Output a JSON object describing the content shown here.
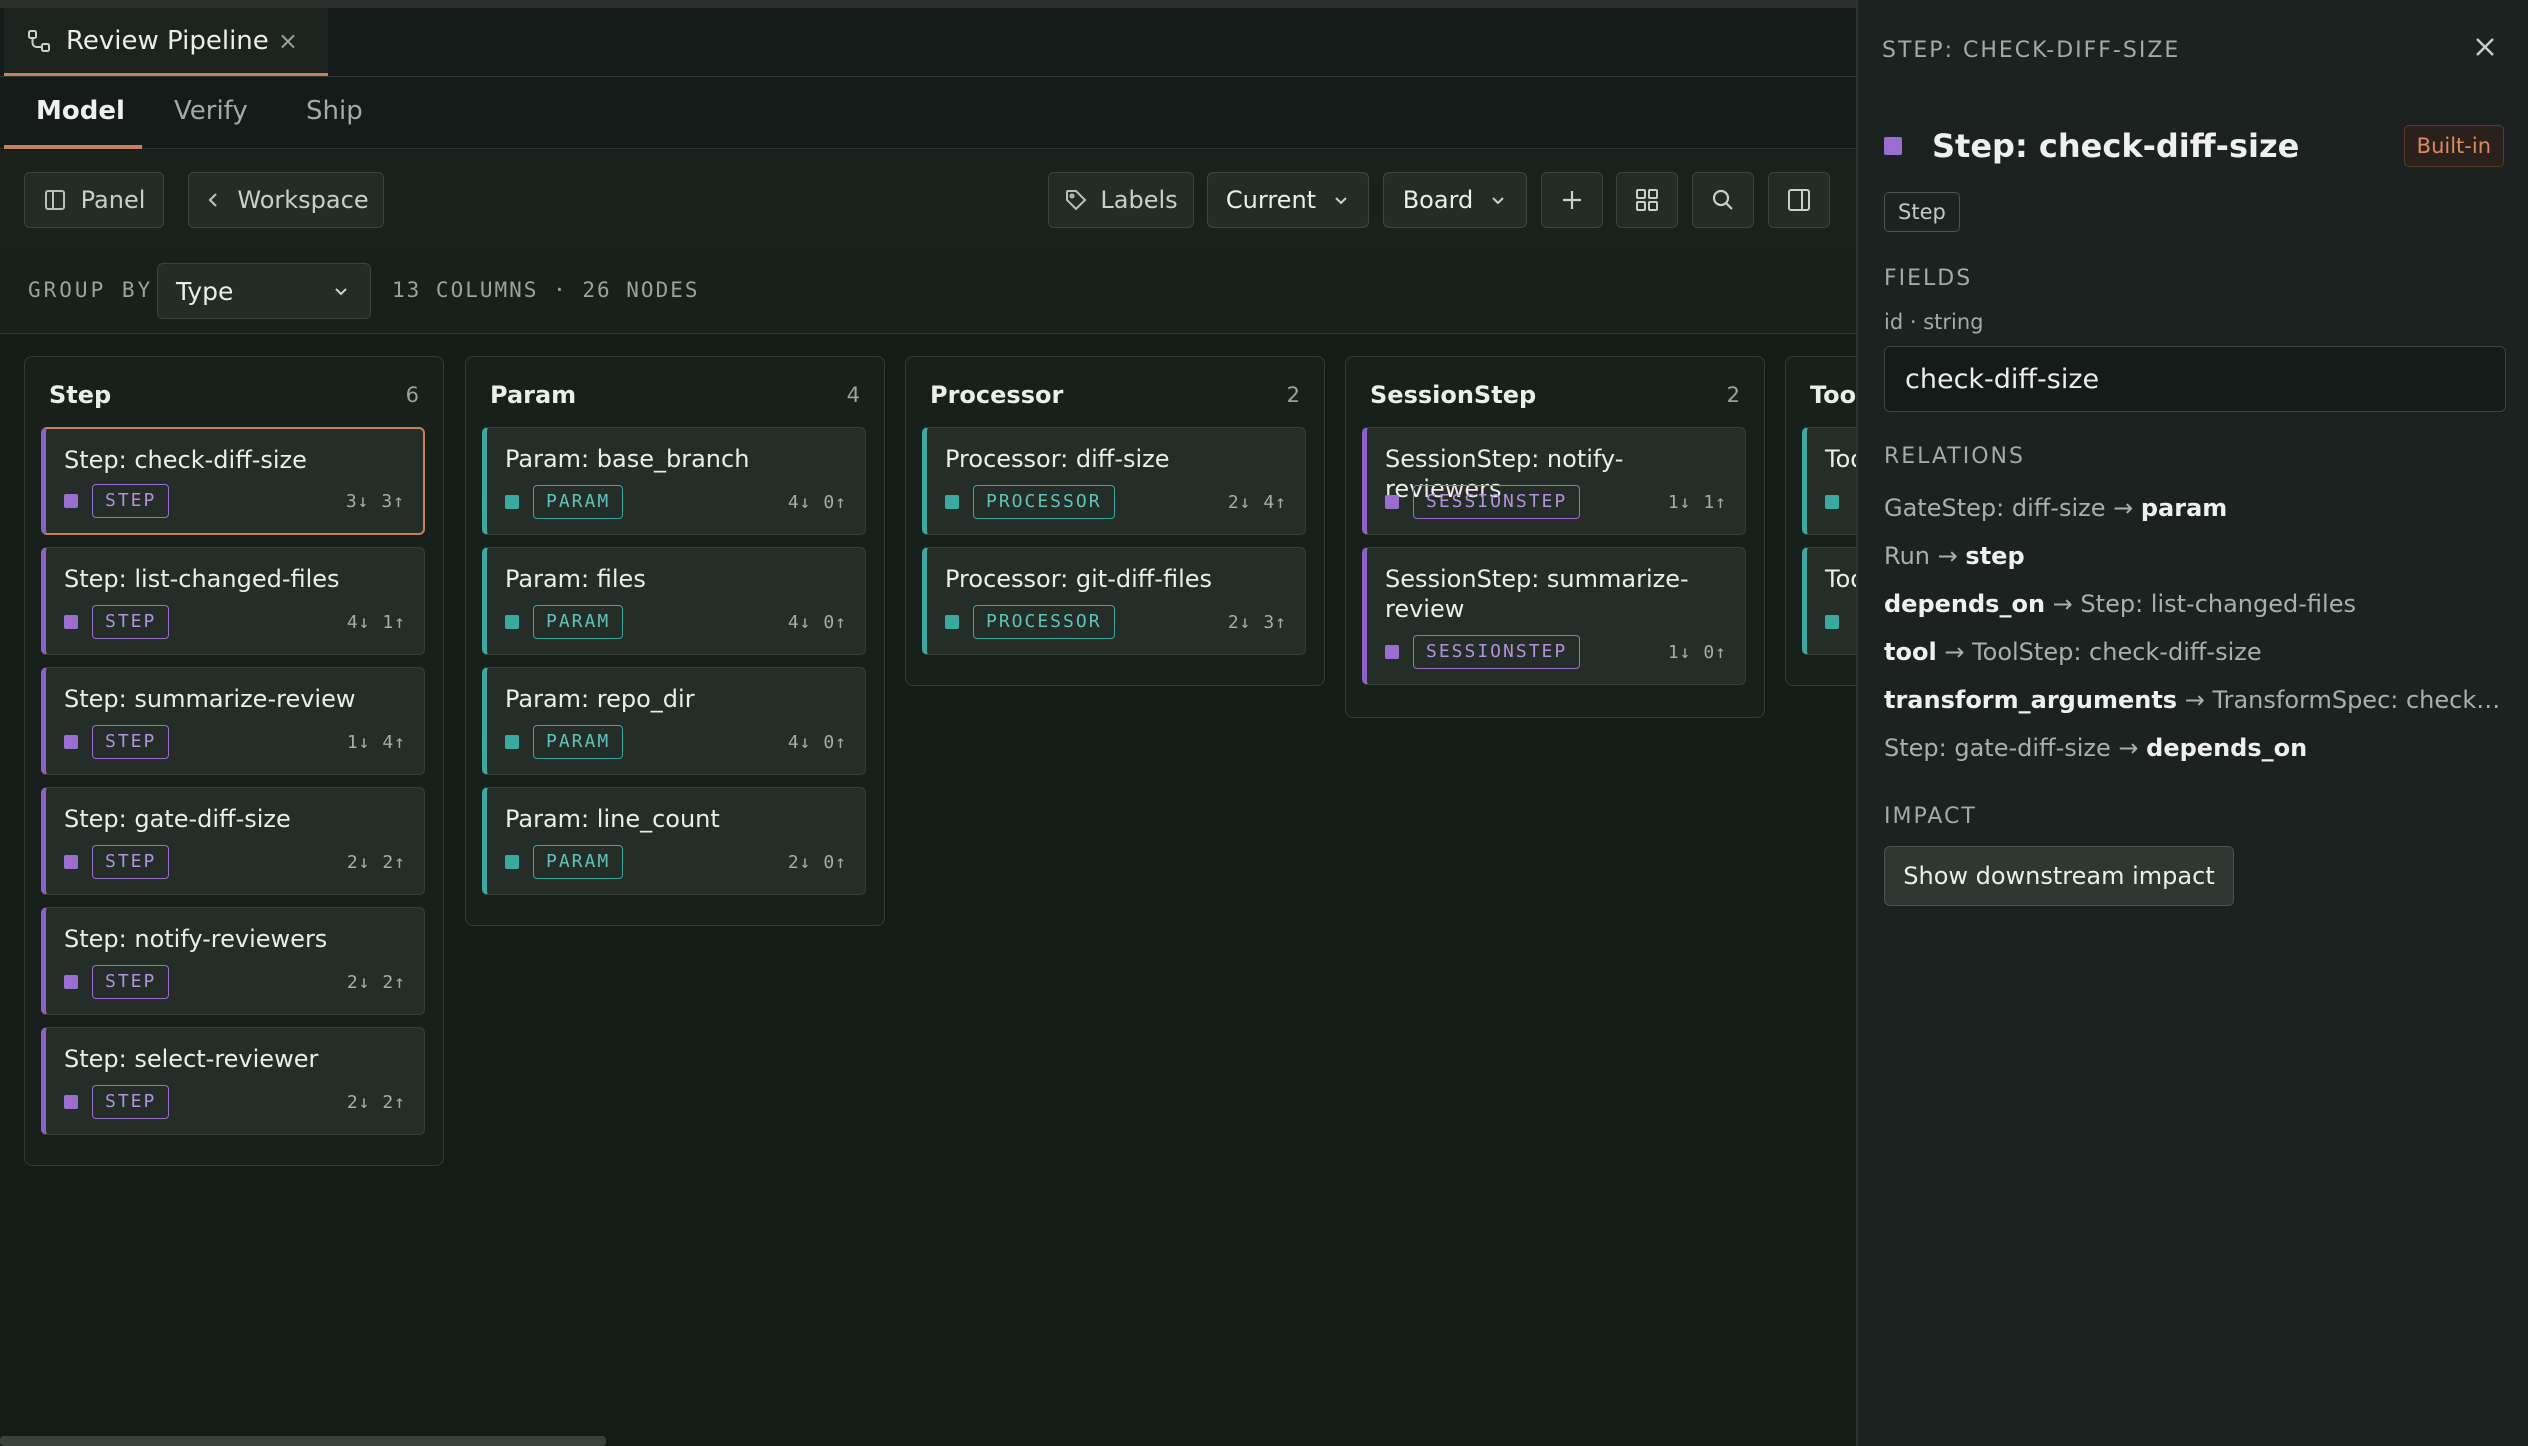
{
  "tab": {
    "title": "Review Pipeline",
    "close": "×"
  },
  "subtabs": [
    "Model",
    "Verify",
    "Ship"
  ],
  "toolbar": {
    "panel_label": "Panel",
    "workspace_label": "Workspace",
    "labels_label": "Labels",
    "version_select": "Current",
    "view_select": "Board"
  },
  "groupbar": {
    "label": "GROUP BY",
    "select": "Type",
    "stats": "13 COLUMNS · 26 NODES"
  },
  "columns": [
    {
      "title": "Step",
      "count": "6",
      "cards": [
        {
          "title": "Step: check-diff-size",
          "badge": "STEP",
          "counts": "3↓ 3↑"
        },
        {
          "title": "Step: list-changed-files",
          "badge": "STEP",
          "counts": "4↓ 1↑"
        },
        {
          "title": "Step: summarize-review",
          "badge": "STEP",
          "counts": "1↓ 4↑"
        },
        {
          "title": "Step: gate-diff-size",
          "badge": "STEP",
          "counts": "2↓ 2↑"
        },
        {
          "title": "Step: notify-reviewers",
          "badge": "STEP",
          "counts": "2↓ 2↑"
        },
        {
          "title": "Step: select-reviewer",
          "badge": "STEP",
          "counts": "2↓ 2↑"
        }
      ]
    },
    {
      "title": "Param",
      "count": "4",
      "cards": [
        {
          "title": "Param: base_branch",
          "badge": "PARAM",
          "counts": "4↓ 0↑"
        },
        {
          "title": "Param: files",
          "badge": "PARAM",
          "counts": "4↓ 0↑"
        },
        {
          "title": "Param: repo_dir",
          "badge": "PARAM",
          "counts": "4↓ 0↑"
        },
        {
          "title": "Param: line_count",
          "badge": "PARAM",
          "counts": "2↓ 0↑"
        }
      ]
    },
    {
      "title": "Processor",
      "count": "2",
      "cards": [
        {
          "title": "Processor: diff-size",
          "badge": "PROCESSOR",
          "counts": "2↓ 4↑"
        },
        {
          "title": "Processor: git-diff-files",
          "badge": "PROCESSOR",
          "counts": "2↓ 3↑"
        }
      ]
    },
    {
      "title": "SessionStep",
      "count": "2",
      "cards": [
        {
          "title": "SessionStep: notify-reviewers",
          "badge": "SESSIONSTEP",
          "counts": "1↓ 1↑"
        },
        {
          "title": "SessionStep: summarize-review",
          "badge": "SESSIONSTEP",
          "counts": "1↓ 0↑"
        }
      ]
    },
    {
      "title": "Tool",
      "cards": [
        {
          "title": "Too"
        },
        {
          "title": "Too"
        }
      ]
    }
  ],
  "panel": {
    "header": "STEP: CHECK-DIFF-SIZE",
    "title": "Step: check-diff-size",
    "builtin": "Built-in",
    "type_chip": "Step",
    "fields_label": "FIELDS",
    "field_meta": "id · string",
    "field_value": "check-diff-size",
    "relations_label": "RELATIONS",
    "relations": [
      {
        "a": "GateStep: diff-size",
        "arrow": " → ",
        "b": "param"
      },
      {
        "a": "Run",
        "arrow": " → ",
        "b": "step"
      },
      {
        "a": "depends_on",
        "arrow": " → ",
        "b": "Step: list-changed-files"
      },
      {
        "a": "tool",
        "arrow": " → ",
        "b": "ToolStep: check-diff-size"
      },
      {
        "a": "transform_arguments",
        "arrow": " → ",
        "b": "TransformSpec: check-diff-size"
      },
      {
        "a": "Step: gate-diff-size",
        "arrow": " → ",
        "b": "depends_on"
      }
    ],
    "impact_label": "IMPACT",
    "impact_button": "Show downstream impact"
  },
  "colors": {
    "accent": "#c8805c",
    "step": "#9a6ed0",
    "param": "#3aa9a0",
    "builtin": "#de8a5e"
  },
  "icons": [
    "pipeline-icon",
    "close-icon",
    "panel-icon",
    "chevron-left-icon",
    "tag-icon",
    "chevron-down-icon",
    "plus-icon",
    "grid-icon",
    "search-icon",
    "sidebar-icon"
  ]
}
